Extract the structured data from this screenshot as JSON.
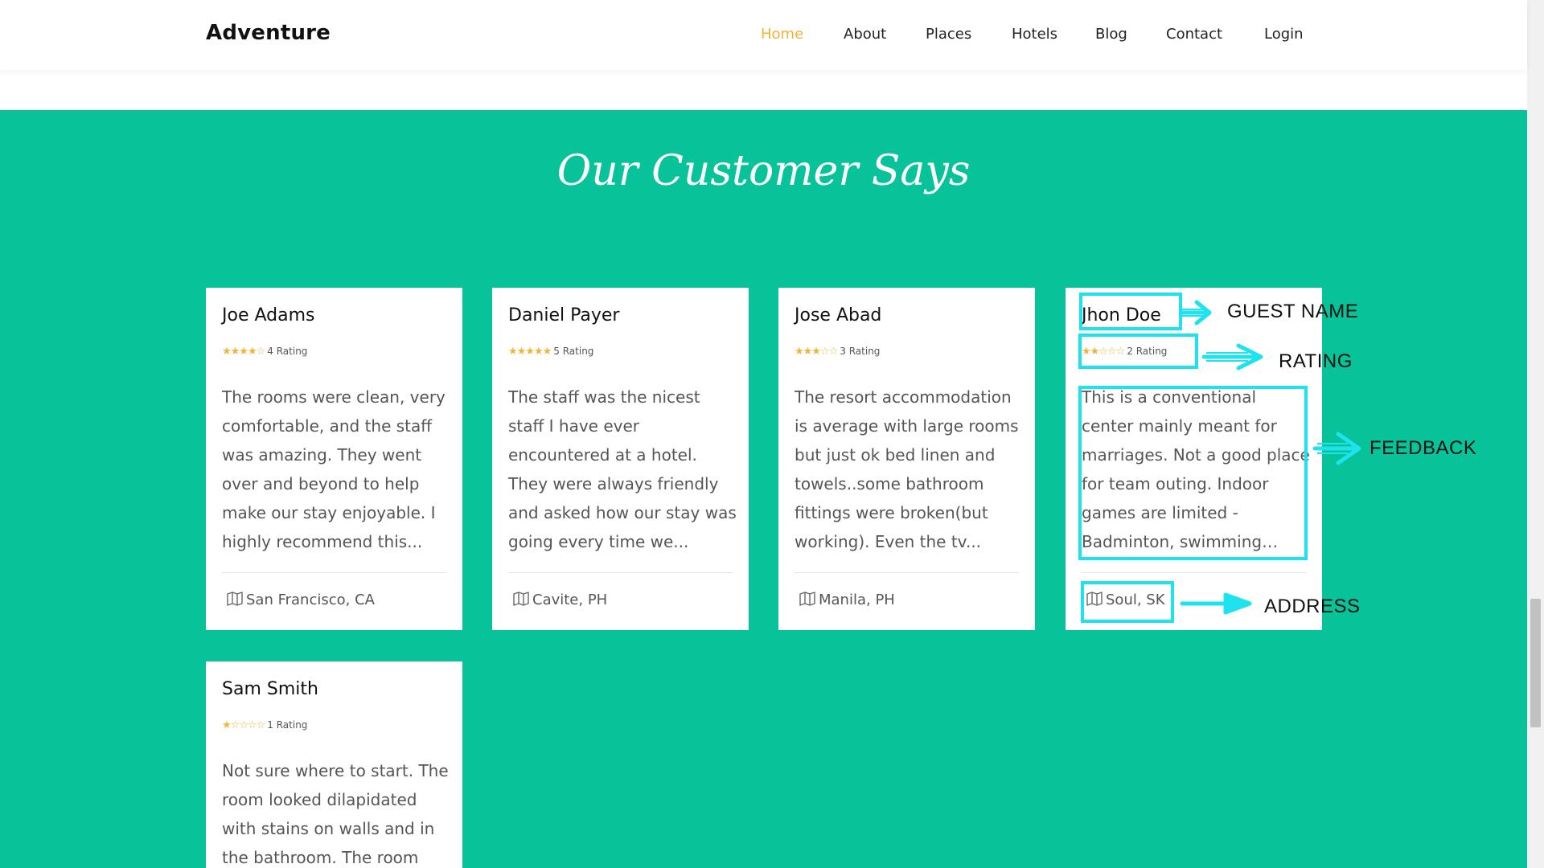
{
  "brand": "Adventure",
  "nav": {
    "items": [
      {
        "label": "Home",
        "active": true
      },
      {
        "label": "About"
      },
      {
        "label": "Places"
      },
      {
        "label": "Hotels"
      },
      {
        "label": "Blog"
      },
      {
        "label": "Contact"
      },
      {
        "label": "Login"
      }
    ],
    "active_color": "#f0b43a"
  },
  "section": {
    "title": "Our Customer Says",
    "background": "#08c399"
  },
  "reviews": [
    {
      "name": "Joe Adams",
      "stars": 4,
      "rating_text": "4 Rating",
      "feedback": "The rooms were clean, very comfortable, and the staff was amazing. They went over and beyond to help make our stay enjoyable. I highly recommend this...",
      "address": "San Francisco, CA"
    },
    {
      "name": "Daniel Payer",
      "stars": 5,
      "rating_text": "5 Rating",
      "feedback": "The staff was the nicest staff I have ever encountered at a hotel. They were always friendly and asked how our stay was going every time we...",
      "address": "Cavite, PH"
    },
    {
      "name": "Jose Abad",
      "stars": 3,
      "rating_text": "3 Rating",
      "feedback": "The resort accommodation is average with large rooms but just ok bed linen and towels..some bathroom fittings were broken(but working). Even the tv...",
      "address": "Manila, PH"
    },
    {
      "name": "Jhon Doe",
      "stars": 2,
      "rating_text": "2 Rating",
      "feedback": "This is a conventional center mainly meant for marriages. Not a good place for team outing. Indoor games are limited - Badminton, swimming poo...",
      "address": "Soul, SK"
    },
    {
      "name": "Sam Smith",
      "stars": 1,
      "rating_text": "1 Rating",
      "feedback": "Not sure where to start. The room looked dilapidated with stains on walls and in the bathroom. The room",
      "address": ""
    }
  ],
  "annotations": {
    "guest_name": "GUEST NAME",
    "rating": "RATING",
    "feedback": "FEEDBACK",
    "address": "ADDRESS",
    "color": "#1ee3ef"
  },
  "icons": {
    "address_icon": "map-icon",
    "star_icon": "star-icon"
  }
}
